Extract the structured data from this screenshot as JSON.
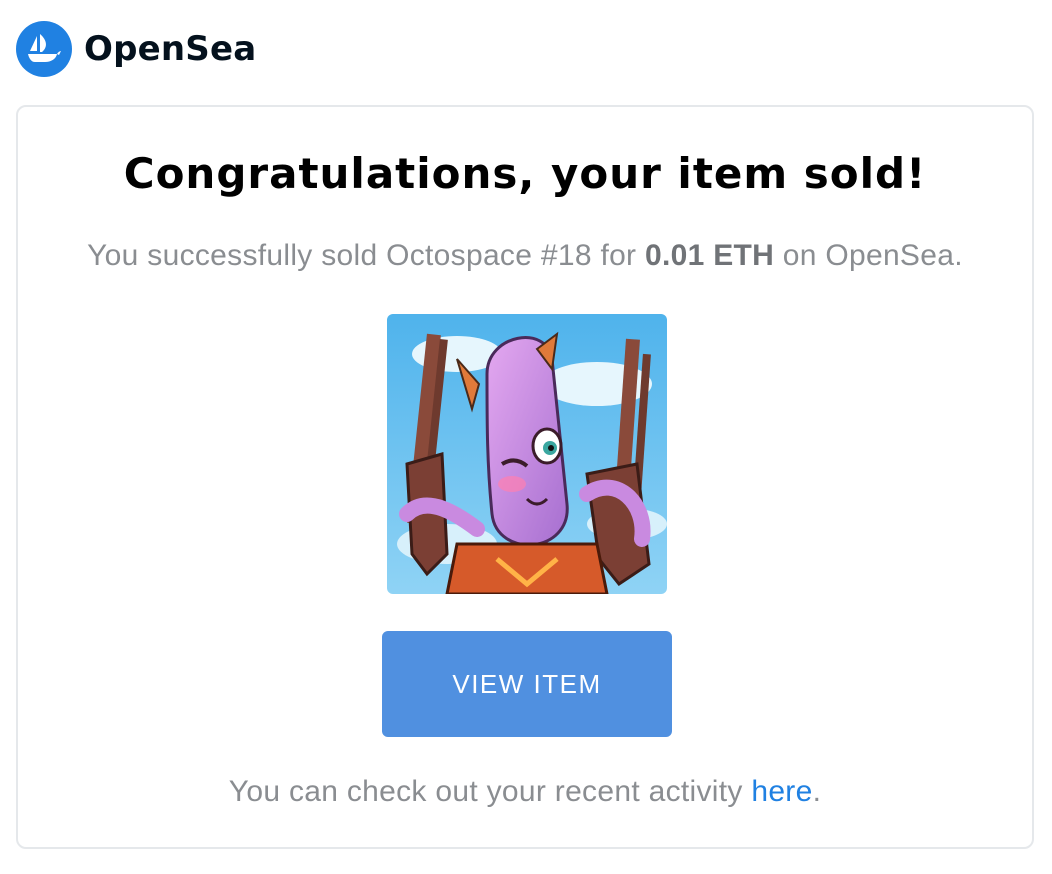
{
  "brand": {
    "name": "OpenSea",
    "logo_icon": "opensea-ship-icon",
    "logo_color": "#2081e2"
  },
  "card": {
    "title": "Congratulations, your item sold!",
    "message_prefix": "You successfully sold Octospace #18 for ",
    "price": "0.01 ETH",
    "message_suffix": " on OpenSea.",
    "image_icon": "nft-octopus-image",
    "button_label": "VIEW ITEM",
    "button_color": "#5090e0",
    "footer_prefix": "You can check out your recent activity ",
    "footer_link": "here",
    "footer_suffix": "."
  }
}
